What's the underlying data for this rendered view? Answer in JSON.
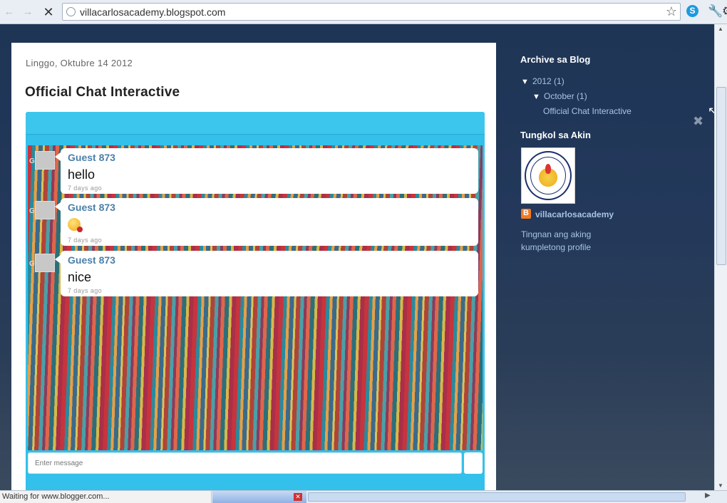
{
  "browser": {
    "url": "villacarlosacademy.blogspot.com",
    "status_text": "Waiting for www.blogger.com..."
  },
  "post": {
    "date": "Linggo, Oktubre 14 2012",
    "title": "Official Chat Interactive"
  },
  "chat": {
    "messages": [
      {
        "initial": "G",
        "name": "Guest 873",
        "text": "hello",
        "time": "7 days ago"
      },
      {
        "initial": "G",
        "name": "Guest 873",
        "text": "",
        "emoji": "emoticon",
        "time": "7 days ago"
      },
      {
        "initial": "G",
        "name": "Guest 873",
        "text": "nice",
        "time": "7 days ago"
      }
    ],
    "input_placeholder": "Enter message"
  },
  "sidebar": {
    "archive_title": "Archive sa Blog",
    "year": "2012",
    "year_count": "(1)",
    "month": "October",
    "month_count": "(1)",
    "archive_post": "Official Chat Interactive",
    "about_title": "Tungkol sa Akin",
    "profile_name": "villacarlosacademy",
    "profile_link": "Tingnan ang aking kumpletong profile"
  },
  "colors": {
    "chat_accent": "#33c0ea",
    "link": "#a9c4e4",
    "page_bg": "#1e3556"
  }
}
